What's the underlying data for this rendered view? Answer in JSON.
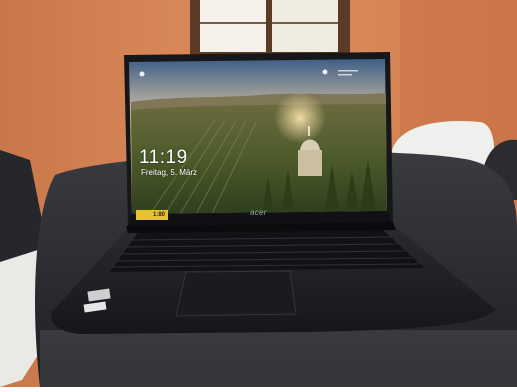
{
  "lockscreen": {
    "time": "11:19",
    "date": "Freitag, 5. März"
  },
  "laptop": {
    "brand": "acer",
    "sticker_text": "1:80"
  },
  "colors": {
    "wall": "#d9895a",
    "table": "#2b2c30",
    "laptop_body": "#1d1f24",
    "sky": "#e7c7a3",
    "sticker": "#e8c22a"
  }
}
